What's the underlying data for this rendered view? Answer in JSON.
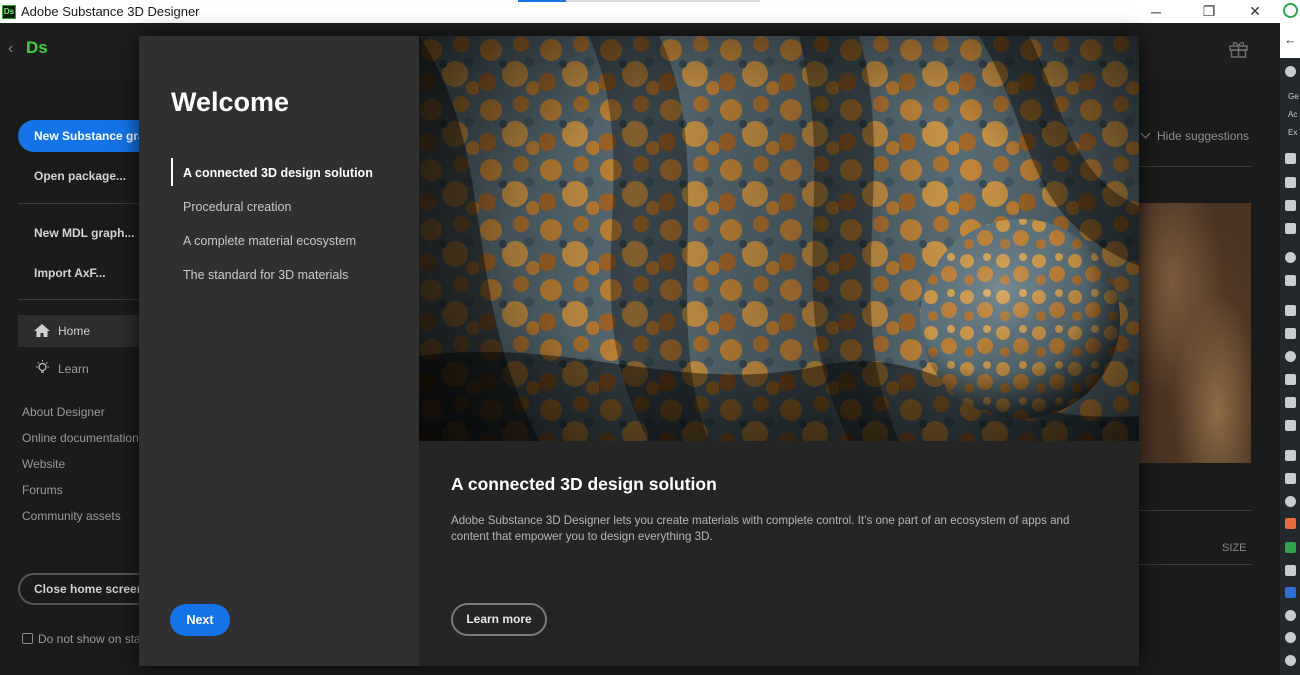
{
  "window": {
    "title": "Adobe Substance 3D Designer",
    "app_icon_text": "Ds",
    "minimize": "─",
    "maximize": "❐",
    "close": "✕"
  },
  "header": {
    "logo_text": "Ds",
    "back_glyph": "‹"
  },
  "sidebar": {
    "new_graph": "New Substance graph...",
    "open_package": "Open package...",
    "new_mdl": "New MDL graph...",
    "import_axf": "Import AxF...",
    "nav": [
      {
        "label": "Home",
        "icon": "home-icon"
      },
      {
        "label": "Learn",
        "icon": "lightbulb-icon"
      }
    ],
    "links": [
      "About Designer",
      "Online documentation",
      "Website",
      "Forums",
      "Community assets"
    ],
    "close_home": "Close home screen",
    "do_not_show": "Do not show on startup"
  },
  "background_right": {
    "hide_suggestions": "Hide suggestions",
    "size_label": "SIZE"
  },
  "dialog": {
    "title": "Welcome",
    "topics": [
      "A connected 3D design solution",
      "Procedural creation",
      "A complete material ecosystem",
      "The standard for 3D materials"
    ],
    "active_topic_index": 0,
    "next_label": "Next",
    "content_title": "A connected 3D design solution",
    "content_body": "Adobe Substance 3D Designer lets you create materials with complete control. It’s one part of an ecosystem of apps and content that empower you to design everything 3D.",
    "learn_more_label": "Learn more"
  },
  "colors": {
    "accent": "#1473e6",
    "background": "#1b1b1b",
    "dialog_left": "#303030",
    "dialog_right": "#252525",
    "brand_green": "#3ed23e"
  }
}
